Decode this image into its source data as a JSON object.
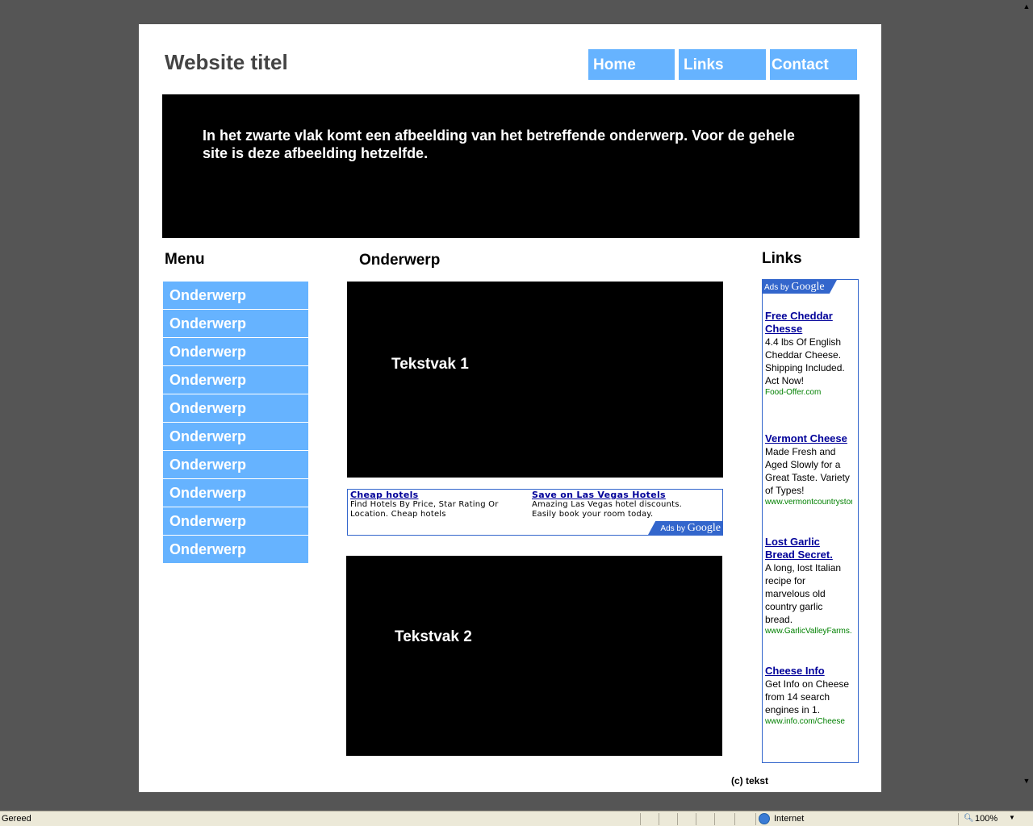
{
  "header": {
    "site_title": "Website titel",
    "nav": [
      "Home",
      "Links",
      "Contact"
    ]
  },
  "banner": {
    "text": "In het zwarte vlak komt een afbeelding van het betreffende onderwerp. Voor de gehele site is deze afbeelding hetzelfde."
  },
  "menu": {
    "heading": "Menu",
    "items": [
      "Onderwerp",
      "Onderwerp",
      "Onderwerp",
      "Onderwerp",
      "Onderwerp",
      "Onderwerp",
      "Onderwerp",
      "Onderwerp",
      "Onderwerp",
      "Onderwerp"
    ]
  },
  "main": {
    "heading": "Onderwerp",
    "textbox1": "Tekstvak 1",
    "textbox2": "Tekstvak 2"
  },
  "ad_banner": {
    "ads": [
      {
        "title": "Cheap hotels",
        "desc": "Find Hotels By Price, Star Rating Or Location. Cheap hotels"
      },
      {
        "title": "Save on Las Vegas Hotels",
        "desc": "Amazing Las Vegas hotel discounts. Easily book your room today."
      }
    ],
    "badge_prefix": "Ads by",
    "badge_brand": "Google"
  },
  "links": {
    "heading": "Links",
    "badge_prefix": "Ads by",
    "badge_brand": "Google",
    "ads": [
      {
        "title": "Free Cheddar Chesse",
        "desc": "4.4 lbs Of English Cheddar Cheese. Shipping Included. Act Now!",
        "url": "Food-Offer.com"
      },
      {
        "title": "Vermont Cheese",
        "desc": "Made Fresh and Aged Slowly for a Great Taste. Variety of Types!",
        "url": "www.vermontcountrystore.com"
      },
      {
        "title": "Lost Garlic Bread Secret.",
        "desc": "A long, lost Italian recipe for marvelous old country garlic bread.",
        "url": "www.GarlicValleyFarms.com"
      },
      {
        "title": "Cheese Info",
        "desc": "Get Info on Cheese from 14 search engines in 1.",
        "url": "www.info.com/Cheese"
      }
    ]
  },
  "footer": {
    "text": "(c) tekst"
  },
  "statusbar": {
    "status": "Gereed",
    "zone": "Internet",
    "zoom": "100%"
  }
}
